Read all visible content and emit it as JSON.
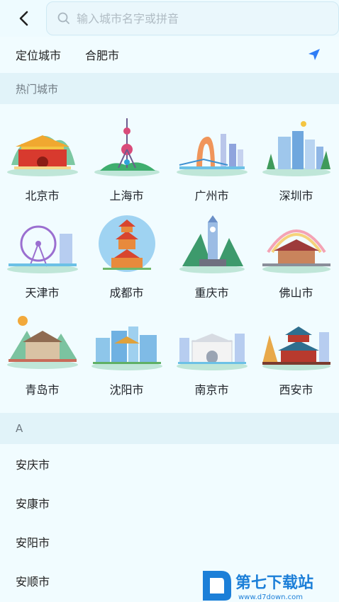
{
  "search": {
    "placeholder": "输入城市名字或拼音"
  },
  "location": {
    "label": "定位城市",
    "city": "合肥市",
    "icon": "location-arrow-icon",
    "accent": "#2f7df6"
  },
  "hot_section": {
    "title": "热门城市"
  },
  "hot_cities": [
    {
      "name": "北京市",
      "icon": "beijing-tiananmen-illustration"
    },
    {
      "name": "上海市",
      "icon": "shanghai-pearl-tower-illustration"
    },
    {
      "name": "广州市",
      "icon": "guangzhou-tower-illustration"
    },
    {
      "name": "深圳市",
      "icon": "shenzhen-skyline-illustration"
    },
    {
      "name": "天津市",
      "icon": "tianjin-eye-illustration"
    },
    {
      "name": "成都市",
      "icon": "chengdu-pagoda-illustration"
    },
    {
      "name": "重庆市",
      "icon": "chongqing-clock-tower-illustration"
    },
    {
      "name": "佛山市",
      "icon": "foshan-ancestral-temple-illustration"
    },
    {
      "name": "青岛市",
      "icon": "qingdao-building-illustration"
    },
    {
      "name": "沈阳市",
      "icon": "shenyang-palace-illustration"
    },
    {
      "name": "南京市",
      "icon": "nanjing-hall-illustration"
    },
    {
      "name": "西安市",
      "icon": "xian-bell-tower-illustration"
    }
  ],
  "alpha_section": {
    "letter": "A"
  },
  "alpha_cities": [
    "安庆市",
    "安康市",
    "安阳市",
    "安顺市"
  ],
  "watermark": {
    "text": "第七下载站",
    "url": "www.d7down.com"
  }
}
